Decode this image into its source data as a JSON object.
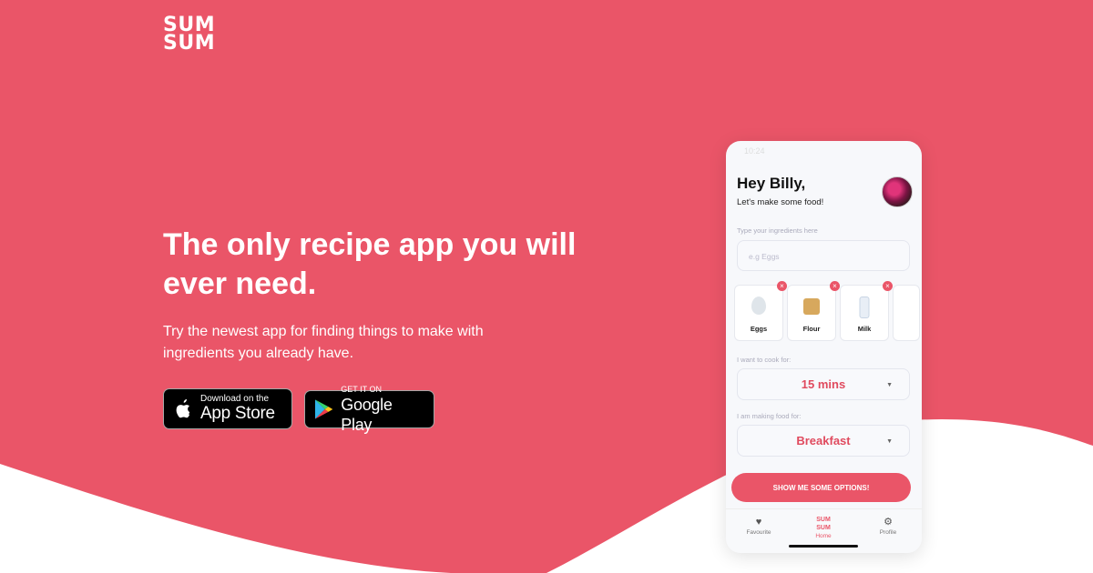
{
  "brand": {
    "line1": "SUM",
    "line2": "SUM"
  },
  "hero": {
    "headline": "The only recipe app you will ever need.",
    "subtext": "Try the newest app for finding things to make with ingredients you already have."
  },
  "stores": {
    "apple": {
      "small": "Download on the",
      "big": "App Store"
    },
    "google": {
      "small": "GET IT ON",
      "big": "Google Play"
    }
  },
  "phone": {
    "time": "10:24",
    "greeting": "Hey Billy,",
    "greeting_sub": "Let's make some food!",
    "ingredients_label": "Type your ingredients here",
    "ingredients_placeholder": "e.g Eggs",
    "ingredients": [
      {
        "name": "Eggs",
        "icon": "egg-icon"
      },
      {
        "name": "Flour",
        "icon": "flour-icon"
      },
      {
        "name": "Milk",
        "icon": "milk-icon"
      }
    ],
    "cook_label": "I want to cook for:",
    "cook_value": "15 mins",
    "meal_label": "I am making food for:",
    "meal_value": "Breakfast",
    "cta": "SHOW ME SOME OPTIONS!",
    "tabs": {
      "favourite": "Favourite",
      "home": "Home",
      "profile": "Profile",
      "home_logo1": "SUM",
      "home_logo2": "SUM"
    }
  },
  "colors": {
    "brand": "#ea5568",
    "white": "#ffffff"
  }
}
